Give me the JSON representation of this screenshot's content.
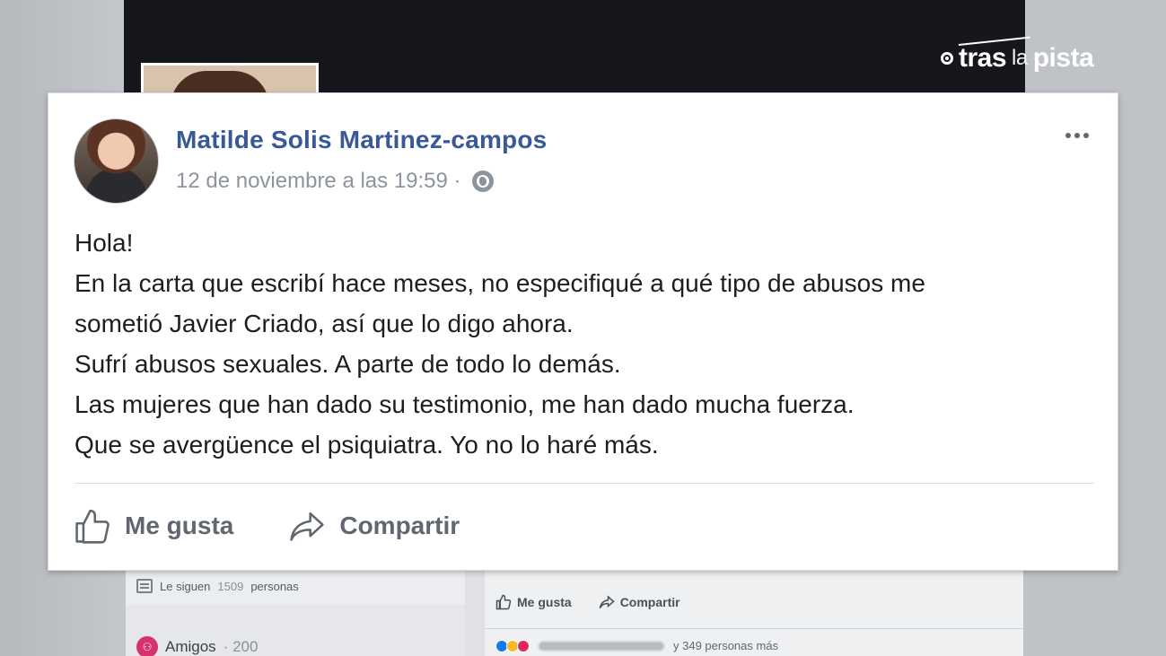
{
  "logo": {
    "word1": "tras",
    "word2": "la",
    "word3": "pista"
  },
  "post": {
    "author": "Matilde Solis Martinez-campos",
    "timestamp": "12 de noviembre a las 19:59 ·",
    "body_lines": [
      "Hola!",
      "En la carta que escribí hace meses, no especifiqué a qué tipo de abusos me",
      "sometió Javier Criado, así que lo digo ahora.",
      "Sufrí abusos sexuales. A parte de todo lo demás.",
      "Las mujeres que han dado su testimonio, me han dado mucha fuerza.",
      "Que se avergüence el psiquiatra. Yo no lo haré más."
    ],
    "actions": {
      "like": "Me gusta",
      "share": "Compartir"
    }
  },
  "background": {
    "followers": {
      "label": "Le siguen",
      "count": "1509",
      "suffix": "personas"
    },
    "friends": {
      "label": "Amigos",
      "count": "· 200"
    },
    "actions": {
      "like": "Me gusta",
      "share": "Compartir"
    },
    "reactions": "y 349 personas más"
  },
  "colors": {
    "author_link": "#385898",
    "text": "#1c1e21",
    "muted": "#8d949e",
    "action": "#606770"
  },
  "icons": [
    "globe-icon",
    "more-options-icon",
    "thumbs-up-icon",
    "share-arrow-icon",
    "tras-la-pista-logo"
  ]
}
